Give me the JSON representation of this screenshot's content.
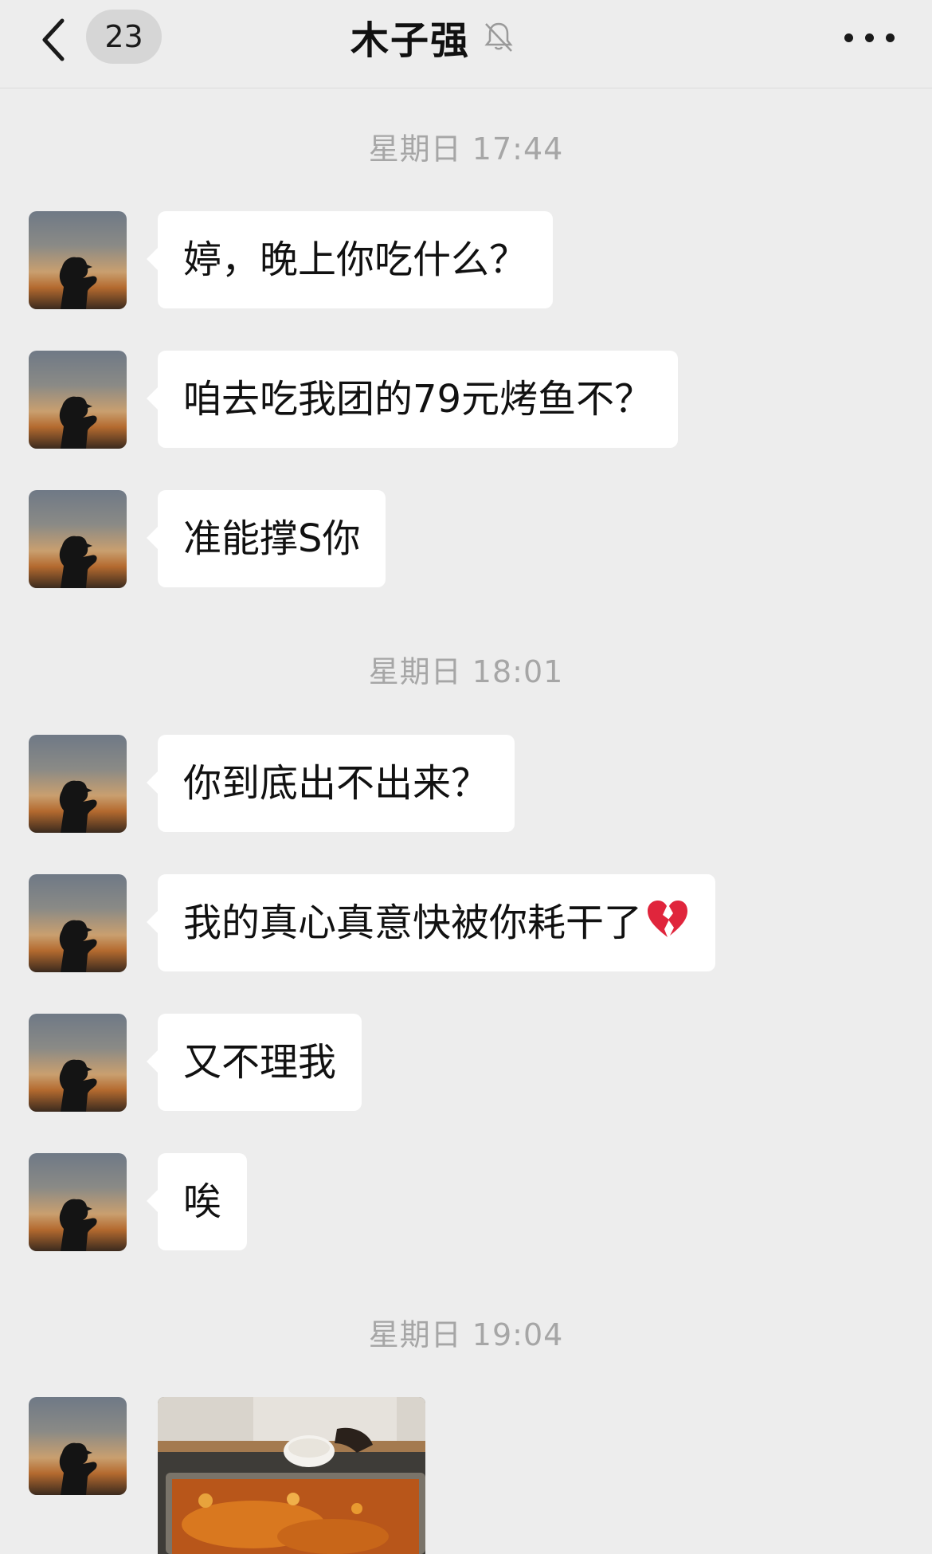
{
  "header": {
    "unread_count": "23",
    "title": "木子强",
    "back_icon": "chevron-left-icon",
    "mute_icon": "bell-slash-icon",
    "more_icon": "ellipsis-icon"
  },
  "timestamps": [
    "星期日 17:44",
    "星期日 18:01",
    "星期日 19:04"
  ],
  "messages": [
    {
      "text": "婷，晚上你吃什么？"
    },
    {
      "text": "咱去吃我团的79元烤鱼不？"
    },
    {
      "text": "准能撑S你"
    },
    {
      "text": "你到底出不出来？"
    },
    {
      "text": "我的真心真意快被你耗干了",
      "emoji": "broken-heart-icon"
    },
    {
      "text": "又不理我"
    },
    {
      "text": "唉"
    }
  ],
  "image_message": {
    "description_icon": "photo-grilled-fish"
  },
  "colors": {
    "background": "#ededed",
    "bubble": "#ffffff",
    "timestamp": "#a6a6a6",
    "badge": "#d6d6d6"
  }
}
